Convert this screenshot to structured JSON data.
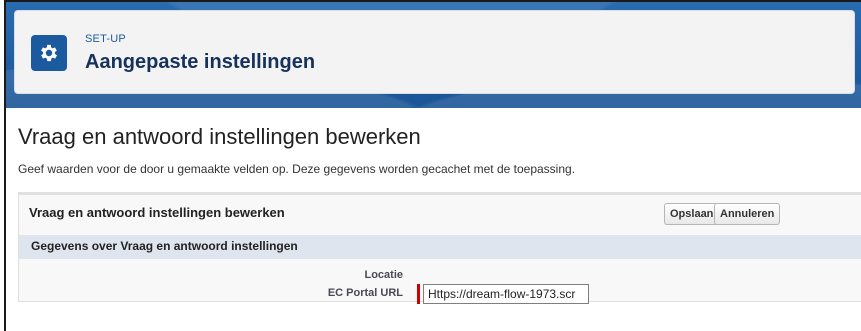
{
  "header": {
    "breadcrumb": "SET-UP",
    "title": "Aangepaste instellingen",
    "icon": "gear-icon"
  },
  "main": {
    "heading": "Vraag en antwoord instellingen bewerken",
    "description": "Geef waarden voor de door u gemaakte velden op. Deze gegevens worden gecachet met de toepassing."
  },
  "panel": {
    "title": "Vraag en antwoord instellingen bewerken",
    "save_label": "Opslaan",
    "cancel_label": "Annuleren",
    "section_title": "Gegevens over Vraag en antwoord instellingen",
    "fields": {
      "location_label": "Locatie",
      "url_label": "EC Portal URL",
      "url_value": "Https://dream-flow-1973.scr"
    }
  },
  "colors": {
    "brand": "#1b5a9e",
    "required": "#cc0000"
  }
}
